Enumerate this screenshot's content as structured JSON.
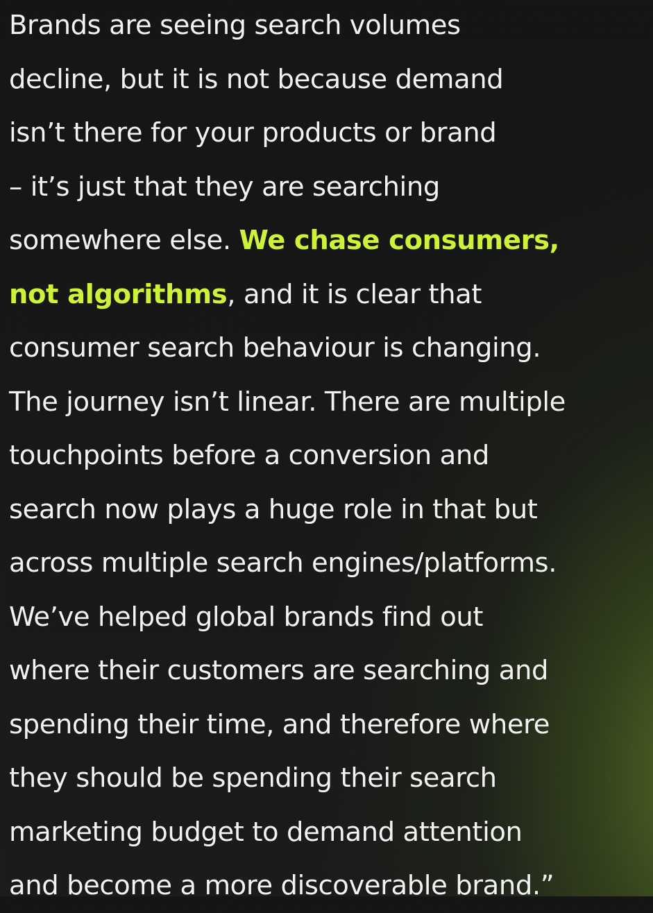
{
  "quote": {
    "lines": [
      "Brands are seeing search volumes",
      "decline, but it is not because demand",
      "isn’t there for your products or brand",
      "– it’s just that they are searching",
      {
        "before": "somewhere else. ",
        "highlight": "We chase consumers,"
      },
      {
        "highlight": "not algorithms",
        "after": ", and it is clear that"
      },
      "consumer search behaviour is changing.",
      "The journey isn’t linear. There are multiple",
      "touchpoints before a conversion and",
      "search now plays a huge role in that but",
      "across multiple search engines/platforms.",
      "We’ve helped global brands find out",
      "where their customers are searching and",
      "spending their time, and therefore where",
      "they should be spending their search",
      "marketing budget to demand attention",
      "and become a more discoverable brand.”"
    ],
    "highlight_color": "#cdf23a",
    "text_color": "#f2f2f2"
  }
}
